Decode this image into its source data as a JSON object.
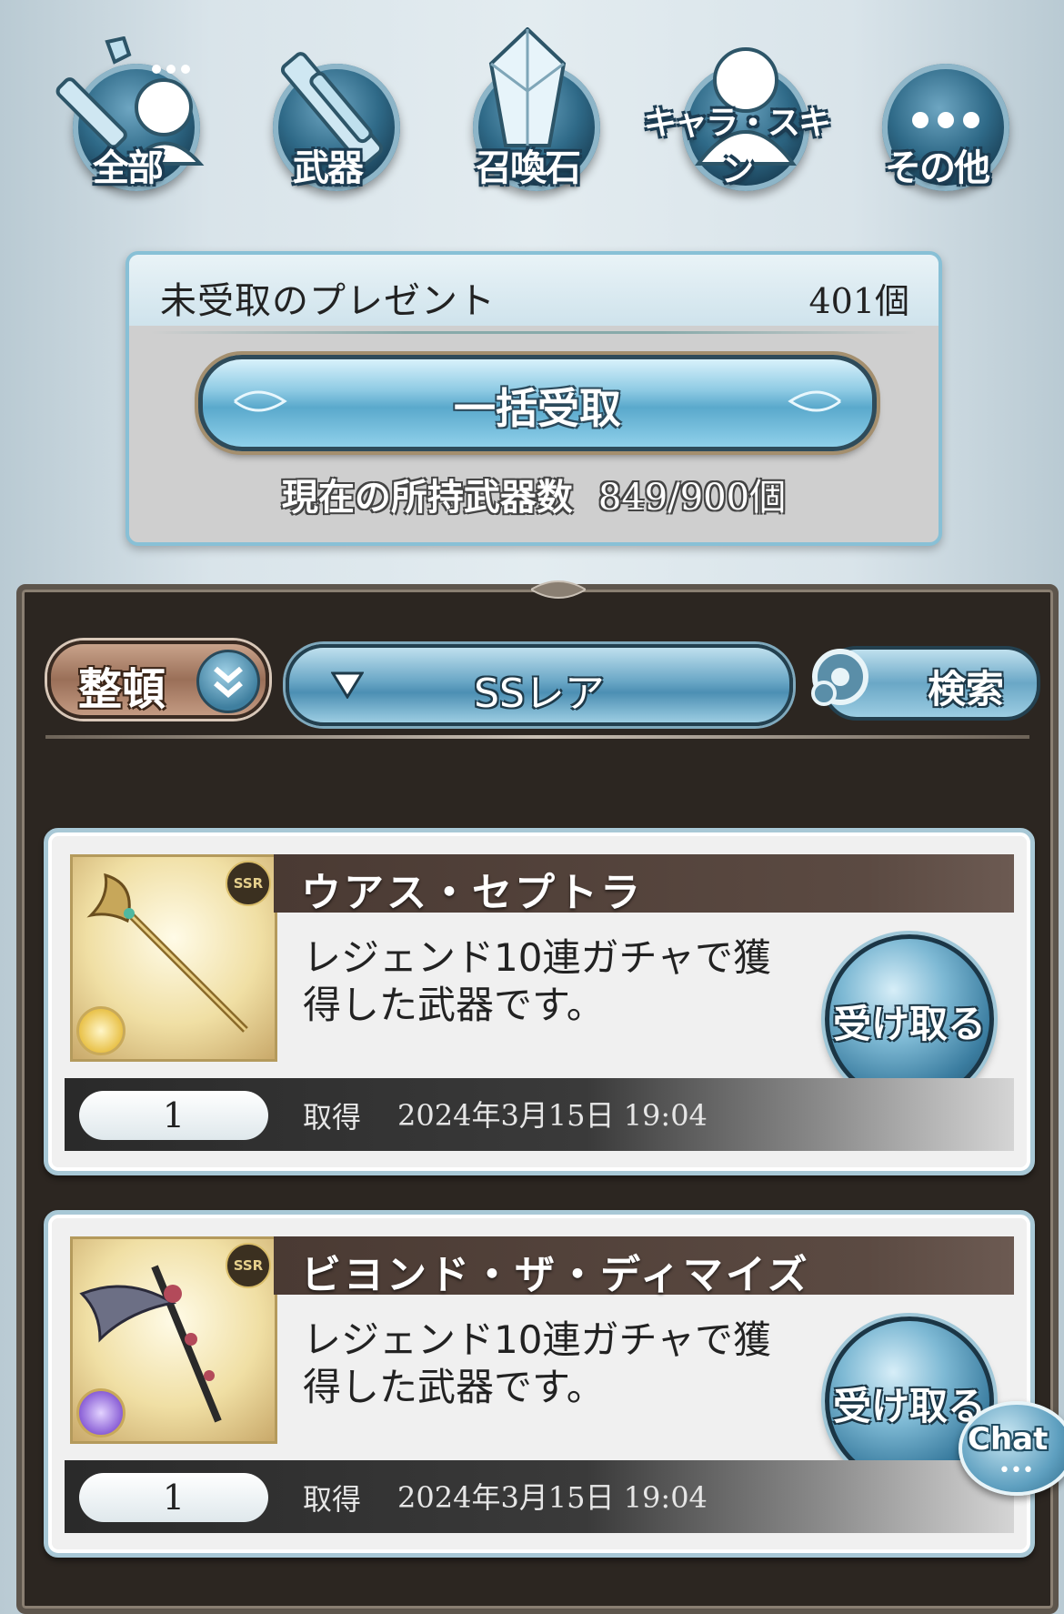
{
  "categories": [
    {
      "label": "全部",
      "icon": "character-weapon-icon"
    },
    {
      "label": "武器",
      "icon": "sword-icon"
    },
    {
      "label": "召喚石",
      "icon": "crystal-icon"
    },
    {
      "label": "キャラ・スキン",
      "icon": "character-silhouette-icon"
    },
    {
      "label": "その他",
      "icon": "more-dots-icon"
    }
  ],
  "summary": {
    "title": "未受取のプレゼント",
    "count": "401個",
    "bulk_receive_label": "一括受取",
    "holding_label": "現在の所持武器数",
    "holding_value": "849/900個"
  },
  "toolbar": {
    "sort_label": "整頓",
    "filter_value": "SSレア",
    "search_label": "検索"
  },
  "items": [
    {
      "name": "ウアス・セプトラ",
      "rarity": "SSR",
      "element_color": "#e9c24a",
      "description": "レジェンド10連ガチャで獲得した武器です。",
      "receive_label": "受け取る",
      "quantity": "1",
      "acquired_label": "取得",
      "acquired_date": "2024年3月15日 19:04"
    },
    {
      "name": "ビヨンド・ザ・ディマイズ",
      "rarity": "SSR",
      "element_color": "#8a5fd6",
      "description": "レジェンド10連ガチャで獲得した武器です。",
      "receive_label": "受け取る",
      "quantity": "1",
      "acquired_label": "取得",
      "acquired_date": "2024年3月15日 19:04"
    }
  ],
  "chat": {
    "label": "Chat"
  }
}
